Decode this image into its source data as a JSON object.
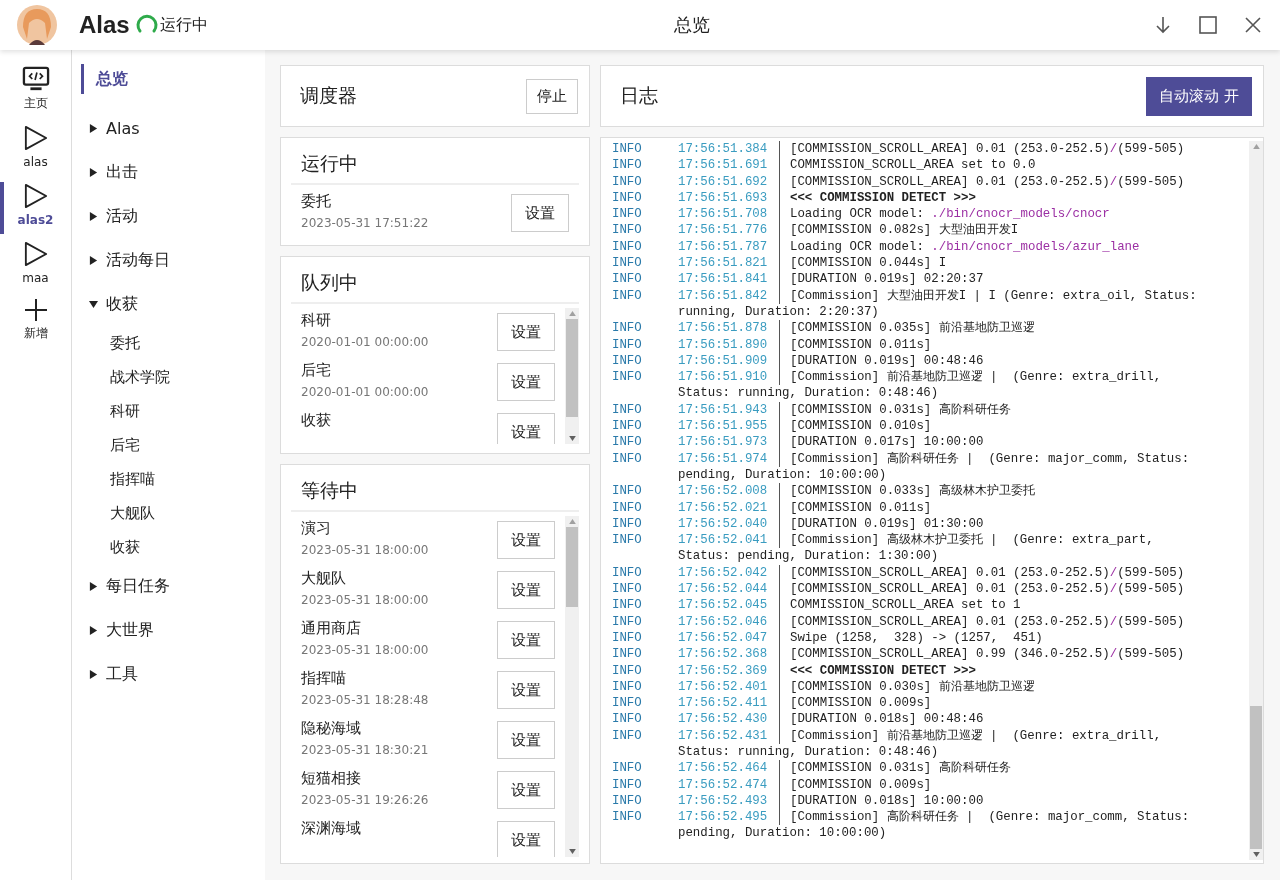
{
  "app": {
    "name": "Alas",
    "status": "运行中",
    "title": "总览"
  },
  "instances": [
    {
      "label": "主页",
      "kind": "home",
      "selected": false
    },
    {
      "label": "alas",
      "kind": "play",
      "selected": false
    },
    {
      "label": "alas2",
      "kind": "play",
      "selected": true
    },
    {
      "label": "maa",
      "kind": "play",
      "selected": false
    },
    {
      "label": "新增",
      "kind": "add",
      "selected": false
    }
  ],
  "nav": [
    {
      "label": "总览",
      "selected": true,
      "kind": "page"
    },
    {
      "label": "Alas",
      "kind": "group",
      "expanded": false,
      "selected": false
    },
    {
      "label": "出击",
      "kind": "group",
      "expanded": false,
      "selected": false
    },
    {
      "label": "活动",
      "kind": "group",
      "expanded": false,
      "selected": false
    },
    {
      "label": "活动每日",
      "kind": "group",
      "expanded": false,
      "selected": false
    },
    {
      "label": "收获",
      "kind": "group",
      "expanded": true,
      "selected": false,
      "children": [
        {
          "label": "委托",
          "selected": false
        },
        {
          "label": "战术学院",
          "selected": false
        },
        {
          "label": "科研",
          "selected": false
        },
        {
          "label": "后宅",
          "selected": false
        },
        {
          "label": "指挥喵",
          "selected": false
        },
        {
          "label": "大舰队",
          "selected": false
        },
        {
          "label": "收获",
          "selected": false
        }
      ]
    },
    {
      "label": "每日任务",
      "kind": "group",
      "expanded": false,
      "selected": false
    },
    {
      "label": "大世界",
      "kind": "group",
      "expanded": false,
      "selected": false
    },
    {
      "label": "工具",
      "kind": "group",
      "expanded": false,
      "selected": false
    }
  ],
  "scheduler": {
    "title": "调度器",
    "button": "停止"
  },
  "running": {
    "title": "运行中",
    "items": [
      {
        "name": "委托",
        "time": "2023-05-31 17:51:22",
        "button": "设置"
      }
    ]
  },
  "queued": {
    "title": "队列中",
    "items": [
      {
        "name": "科研",
        "time": "2020-01-01 00:00:00",
        "button": "设置"
      },
      {
        "name": "后宅",
        "time": "2020-01-01 00:00:00",
        "button": "设置"
      },
      {
        "name": "收获",
        "button": "设置"
      }
    ]
  },
  "waiting": {
    "title": "等待中",
    "items": [
      {
        "name": "演习",
        "time": "2023-05-31 18:00:00",
        "button": "设置"
      },
      {
        "name": "大舰队",
        "time": "2023-05-31 18:00:00",
        "button": "设置"
      },
      {
        "name": "通用商店",
        "time": "2023-05-31 18:00:00",
        "button": "设置"
      },
      {
        "name": "指挥喵",
        "time": "2023-05-31 18:28:48",
        "button": "设置"
      },
      {
        "name": "隐秘海域",
        "time": "2023-05-31 18:30:21",
        "button": "设置"
      },
      {
        "name": "短猫相接",
        "time": "2023-05-31 19:26:26",
        "button": "设置"
      },
      {
        "name": "深渊海域",
        "button": "设置"
      }
    ]
  },
  "log": {
    "title": "日志",
    "autoscroll_button": "自动滚动 开",
    "lines": [
      {
        "level": "INFO",
        "time": "17:56:51.384",
        "parts": [
          {
            "text": "[COMMISSION_SCROLL_AREA] 0.01 (253.0-252.5)",
            "kind": "plain"
          },
          {
            "text": "/",
            "kind": "path"
          },
          {
            "text": "(599-505)",
            "kind": "plain"
          }
        ]
      },
      {
        "level": "INFO",
        "time": "17:56:51.691",
        "parts": [
          {
            "text": "COMMISSION_SCROLL_AREA set to 0.0",
            "kind": "plain"
          }
        ]
      },
      {
        "level": "INFO",
        "time": "17:56:51.692",
        "parts": [
          {
            "text": "[COMMISSION_SCROLL_AREA] 0.01 (253.0-252.5)",
            "kind": "plain"
          },
          {
            "text": "/",
            "kind": "path"
          },
          {
            "text": "(599-505)",
            "kind": "plain"
          }
        ]
      },
      {
        "level": "INFO",
        "time": "17:56:51.693",
        "parts": [
          {
            "text": "<<< COMMISSION DETECT >>>",
            "kind": "bold"
          }
        ]
      },
      {
        "level": "INFO",
        "time": "17:56:51.708",
        "parts": [
          {
            "text": "Loading OCR model: ",
            "kind": "plain"
          },
          {
            "text": "./bin/cnocr_models/cnocr",
            "kind": "path"
          }
        ]
      },
      {
        "level": "INFO",
        "time": "17:56:51.776",
        "parts": [
          {
            "text": "[COMMISSION 0.082s] 大型油田开发I",
            "kind": "plain"
          }
        ]
      },
      {
        "level": "INFO",
        "time": "17:56:51.787",
        "parts": [
          {
            "text": "Loading OCR model: ",
            "kind": "plain"
          },
          {
            "text": "./bin/cnocr_models/azur_lane",
            "kind": "path"
          }
        ]
      },
      {
        "level": "INFO",
        "time": "17:56:51.821",
        "parts": [
          {
            "text": "[COMMISSION 0.044s] I",
            "kind": "plain"
          }
        ]
      },
      {
        "level": "INFO",
        "time": "17:56:51.841",
        "parts": [
          {
            "text": "[DURATION 0.019s] 02:20:37",
            "kind": "plain"
          }
        ]
      },
      {
        "level": "INFO",
        "time": "17:56:51.842",
        "parts": [
          {
            "text": "[Commission] 大型油田开发I | I (Genre: extra_oil, Status:",
            "kind": "plain"
          }
        ],
        "cont": "running, Duration: 2:20:37)"
      },
      {
        "level": "INFO",
        "time": "17:56:51.878",
        "parts": [
          {
            "text": "[COMMISSION 0.035s] 前沿基地防卫巡逻",
            "kind": "plain"
          }
        ]
      },
      {
        "level": "INFO",
        "time": "17:56:51.890",
        "parts": [
          {
            "text": "[COMMISSION 0.011s]",
            "kind": "plain"
          }
        ]
      },
      {
        "level": "INFO",
        "time": "17:56:51.909",
        "parts": [
          {
            "text": "[DURATION 0.019s] 00:48:46",
            "kind": "plain"
          }
        ]
      },
      {
        "level": "INFO",
        "time": "17:56:51.910",
        "parts": [
          {
            "text": "[Commission] 前沿基地防卫巡逻 |  (Genre: extra_drill,",
            "kind": "plain"
          }
        ],
        "cont": "Status: running, Duration: 0:48:46)"
      },
      {
        "level": "INFO",
        "time": "17:56:51.943",
        "parts": [
          {
            "text": "[COMMISSION 0.031s] 高阶科研任务",
            "kind": "plain"
          }
        ]
      },
      {
        "level": "INFO",
        "time": "17:56:51.955",
        "parts": [
          {
            "text": "[COMMISSION 0.010s]",
            "kind": "plain"
          }
        ]
      },
      {
        "level": "INFO",
        "time": "17:56:51.973",
        "parts": [
          {
            "text": "[DURATION 0.017s] 10:00:00",
            "kind": "plain"
          }
        ]
      },
      {
        "level": "INFO",
        "time": "17:56:51.974",
        "parts": [
          {
            "text": "[Commission] 高阶科研任务 |  (Genre: major_comm, Status:",
            "kind": "plain"
          }
        ],
        "cont": "pending, Duration: 10:00:00)"
      },
      {
        "level": "INFO",
        "time": "17:56:52.008",
        "parts": [
          {
            "text": "[COMMISSION 0.033s] 高级林木护卫委托",
            "kind": "plain"
          }
        ]
      },
      {
        "level": "INFO",
        "time": "17:56:52.021",
        "parts": [
          {
            "text": "[COMMISSION 0.011s]",
            "kind": "plain"
          }
        ]
      },
      {
        "level": "INFO",
        "time": "17:56:52.040",
        "parts": [
          {
            "text": "[DURATION 0.019s] 01:30:00",
            "kind": "plain"
          }
        ]
      },
      {
        "level": "INFO",
        "time": "17:56:52.041",
        "parts": [
          {
            "text": "[Commission] 高级林木护卫委托 |  (Genre: extra_part,",
            "kind": "plain"
          }
        ],
        "cont": "Status: pending, Duration: 1:30:00)"
      },
      {
        "level": "INFO",
        "time": "17:56:52.042",
        "parts": [
          {
            "text": "[COMMISSION_SCROLL_AREA] 0.01 (253.0-252.5)",
            "kind": "plain"
          },
          {
            "text": "/",
            "kind": "path"
          },
          {
            "text": "(599-505)",
            "kind": "plain"
          }
        ]
      },
      {
        "level": "INFO",
        "time": "17:56:52.044",
        "parts": [
          {
            "text": "[COMMISSION_SCROLL_AREA] 0.01 (253.0-252.5)",
            "kind": "plain"
          },
          {
            "text": "/",
            "kind": "path"
          },
          {
            "text": "(599-505)",
            "kind": "plain"
          }
        ]
      },
      {
        "level": "INFO",
        "time": "17:56:52.045",
        "parts": [
          {
            "text": "COMMISSION_SCROLL_AREA set to 1",
            "kind": "plain"
          }
        ]
      },
      {
        "level": "INFO",
        "time": "17:56:52.046",
        "parts": [
          {
            "text": "[COMMISSION_SCROLL_AREA] 0.01 (253.0-252.5)",
            "kind": "plain"
          },
          {
            "text": "/",
            "kind": "path"
          },
          {
            "text": "(599-505)",
            "kind": "plain"
          }
        ]
      },
      {
        "level": "INFO",
        "time": "17:56:52.047",
        "parts": [
          {
            "text": "Swipe (1258,  328) -> (1257,  451)",
            "kind": "plain"
          }
        ]
      },
      {
        "level": "INFO",
        "time": "17:56:52.368",
        "parts": [
          {
            "text": "[COMMISSION_SCROLL_AREA] 0.99 (346.0-252.5)",
            "kind": "plain"
          },
          {
            "text": "/",
            "kind": "path"
          },
          {
            "text": "(599-505)",
            "kind": "plain"
          }
        ]
      },
      {
        "level": "INFO",
        "time": "17:56:52.369",
        "parts": [
          {
            "text": "<<< COMMISSION DETECT >>>",
            "kind": "bold"
          }
        ]
      },
      {
        "level": "INFO",
        "time": "17:56:52.401",
        "parts": [
          {
            "text": "[COMMISSION 0.030s] 前沿基地防卫巡逻",
            "kind": "plain"
          }
        ]
      },
      {
        "level": "INFO",
        "time": "17:56:52.411",
        "parts": [
          {
            "text": "[COMMISSION 0.009s]",
            "kind": "plain"
          }
        ]
      },
      {
        "level": "INFO",
        "time": "17:56:52.430",
        "parts": [
          {
            "text": "[DURATION 0.018s] 00:48:46",
            "kind": "plain"
          }
        ]
      },
      {
        "level": "INFO",
        "time": "17:56:52.431",
        "parts": [
          {
            "text": "[Commission] 前沿基地防卫巡逻 |  (Genre: extra_drill,",
            "kind": "plain"
          }
        ],
        "cont": "Status: running, Duration: 0:48:46)"
      },
      {
        "level": "INFO",
        "time": "17:56:52.464",
        "parts": [
          {
            "text": "[COMMISSION 0.031s] 高阶科研任务",
            "kind": "plain"
          }
        ]
      },
      {
        "level": "INFO",
        "time": "17:56:52.474",
        "parts": [
          {
            "text": "[COMMISSION 0.009s]",
            "kind": "plain"
          }
        ]
      },
      {
        "level": "INFO",
        "time": "17:56:52.493",
        "parts": [
          {
            "text": "[DURATION 0.018s] 10:00:00",
            "kind": "plain"
          }
        ]
      },
      {
        "level": "INFO",
        "time": "17:56:52.495",
        "parts": [
          {
            "text": "[Commission] 高阶科研任务 |  (Genre: major_comm, Status:",
            "kind": "plain"
          }
        ],
        "cont": "pending, Duration: 10:00:00)"
      }
    ]
  }
}
